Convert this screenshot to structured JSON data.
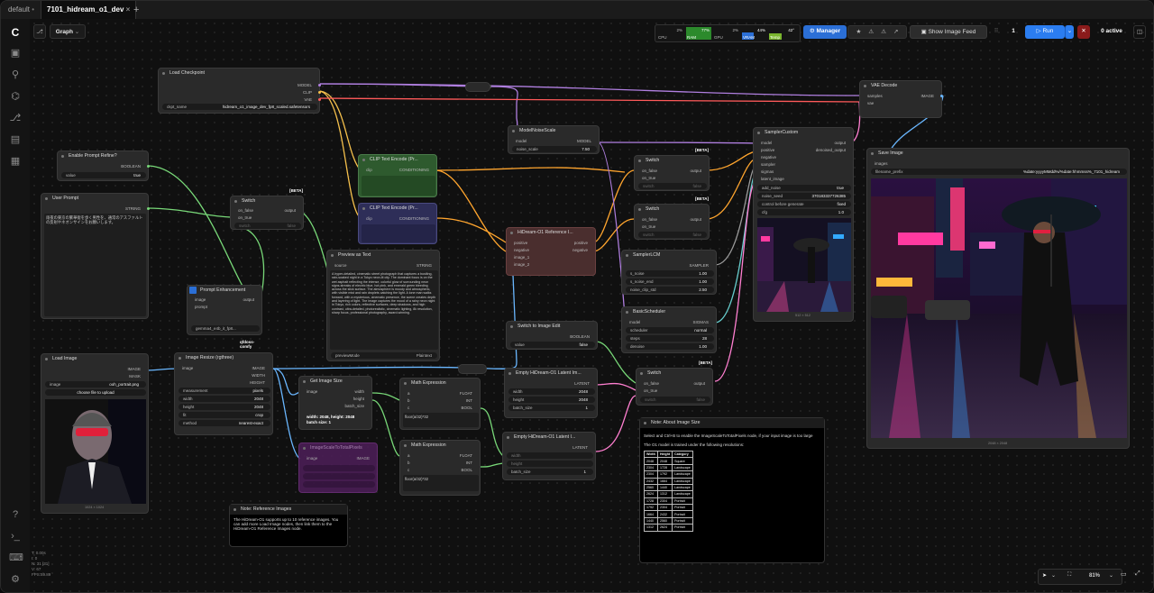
{
  "tabs": [
    {
      "label": "default"
    },
    {
      "label": "7101_hidream_o1_dev"
    }
  ],
  "graph_label": "Graph",
  "stats": {
    "cpu_pct": "2%",
    "cpu": "CPU",
    "ram_pct": "77%",
    "ram": "RAM",
    "gpu_pct": "2%",
    "gpu": "GPU",
    "vram_pct": "44%",
    "vram": "VRAM",
    "temp": "42°",
    "temp_label": "Temp"
  },
  "toolbar": {
    "manager": "Manager",
    "show_feed": "Show Image Feed",
    "queue_count": "1",
    "run": "Run",
    "active": "0 active"
  },
  "nodes": {
    "load_checkpoint": {
      "title": "Load Checkpoint",
      "out1": "MODEL",
      "out2": "CLIP",
      "out3": "VAE",
      "w_label": "ckpt_name",
      "w_value": "hidream_o1_image_dev_fp8_scaled.safetensors"
    },
    "enable_prompt": {
      "title": "Enable Prompt Refine?",
      "out": "BOOLEAN",
      "w_label": "value",
      "w_value": "true"
    },
    "user_prompt": {
      "title": "User Prompt",
      "out": "STRING",
      "text": "雨夜の東京の繁華街を歩く男性を、通常のアスファルトの反射やネオンサインをお願いします。"
    },
    "switch1": {
      "title": "Switch",
      "badge": "[BETA]",
      "in1": "on_false",
      "in2": "on_true",
      "out": "output",
      "w1": "switch",
      "w1v": "false"
    },
    "prompt_enh": {
      "title": "Prompt Enhancement",
      "in1": "image",
      "in2": "prompt",
      "out": "output",
      "w1": "gemma4_e4b_it_fp8...",
      "sub": "qfdoss-comfy"
    },
    "clip1": {
      "title": "CLIP Text Encode (Pr...",
      "in": "clip",
      "out": "CONDITIONING"
    },
    "clip2": {
      "title": "CLIP Text Encode (Pr...",
      "in": "clip",
      "out": "CONDITIONING"
    },
    "preview_text": {
      "title": "Preview as Text",
      "in": "source",
      "out": "STRING",
      "text": "A hyper-detailed, cinematic street photograph that captures a bustling, rain-soaked night in a Tokyo neon-lit city. The dominant focus is on the wet asphalt reflecting the intense, colorful glow of surrounding neon signs-streaks of electric blue, hot pink, and emerald green bleeding across the slick surface. The atmosphere is moody and atmospheric, with visible mist and rain droplets catching the light. A lone man walks forward, with a mysterious, cinematic presence, the scene creates depth and layering of light. The image captures the mood of a rainy neon night in Tokyo, rich colors, reflective surfaces, deep shadows, and high contrast, ultra-detailed, photorealistic, cinematic lighting, 8k resolution, sharp focus, professional photography, award-winning.",
      "w1": "previewMode",
      "w1v": "Plaintext"
    },
    "model_noise": {
      "title": "ModelNoiseScale",
      "in": "model",
      "out": "MODEL",
      "w1": "noise_scale",
      "w1v": "7.50"
    },
    "hidream_ref": {
      "title": "HiDream-O1 Reference I...",
      "in1": "positive",
      "in2": "negative",
      "in3": "image_1",
      "in4": "image_2",
      "out1": "positive",
      "out2": "negative"
    },
    "switch2": {
      "title": "Switch",
      "badge": "[BETA]",
      "in1": "on_false",
      "in2": "on_true",
      "out": "output",
      "w1": "switch",
      "w1v": "false"
    },
    "switch3": {
      "title": "Switch",
      "badge": "[BETA]",
      "in1": "on_false",
      "in2": "on_true",
      "out": "output",
      "w1": "switch",
      "w1v": "false"
    },
    "sampler_lcm": {
      "title": "SamplerLCM",
      "out": "SAMPLER",
      "w1": "s_noise",
      "w1v": "1.00",
      "w2": "s_noise_end",
      "w2v": "1.00",
      "w3": "noise_clip_std",
      "w3v": "2.50"
    },
    "basic_sched": {
      "title": "BasicScheduler",
      "in": "model",
      "out": "SIGMAS",
      "w1": "scheduler",
      "w1v": "normal",
      "w2": "steps",
      "w2v": "28",
      "w3": "denoise",
      "w3v": "1.00"
    },
    "switch_edit": {
      "title": "Switch to Image Edit",
      "out": "BOOLEAN",
      "w1": "value",
      "w1v": "false"
    },
    "empty_latent1": {
      "title": "Empty HiDream-O1 Latent Im...",
      "out": "LATENT",
      "w1": "width",
      "w1v": "2048",
      "w2": "height",
      "w2v": "2048",
      "w3": "batch_size",
      "w3v": "1"
    },
    "switch4": {
      "title": "Switch",
      "badge": "[BETA]",
      "in1": "on_false",
      "in2": "on_true",
      "out": "output",
      "w1": "switch",
      "w1v": "false"
    },
    "empty_latent2": {
      "title": "Empty HiDream-O1 Latent I...",
      "in1": "width",
      "in2": "height",
      "out": "LATENT",
      "w1": "batch_size",
      "w1v": "1"
    },
    "sampler_custom": {
      "title": "SamplerCustom",
      "in1": "model",
      "in2": "positive",
      "in3": "negative",
      "in4": "sampler",
      "in5": "sigmas",
      "in6": "latent_image",
      "out1": "output",
      "out2": "denoised_output",
      "w1": "add_noise",
      "w1v": "true",
      "w2": "noise_seed",
      "w2v": "370183337726385",
      "w3": "control before generate",
      "w3v": "fixed",
      "w4": "cfg",
      "w4v": "1.0",
      "caption": "512 × 512"
    },
    "vae_decode": {
      "title": "VAE Decode",
      "in1": "samples",
      "in2": "vae",
      "out": "IMAGE"
    },
    "save_image": {
      "title": "Save Image",
      "in": "images",
      "w1": "filename_prefix",
      "w1v": "%date:yyyyMMdd%/%date:hhmmss%_7101_hidream",
      "caption": "2048 × 2048"
    },
    "load_image": {
      "title": "Load Image",
      "out1": "IMAGE",
      "out2": "MASK",
      "w1": "image",
      "w1v": "ooh_portrait.png",
      "upload": "choose file to upload",
      "caption": "1024 × 1024"
    },
    "resize": {
      "title": "Image Resize (rgthree)",
      "in": "image",
      "out1": "IMAGE",
      "out2": "WIDTH",
      "out3": "HEIGHT",
      "w1": "measurement",
      "w1v": "pixels",
      "w2": "width",
      "w2v": "2048",
      "w3": "height",
      "w3v": "2048",
      "w4": "fit",
      "w4v": "crop",
      "w5": "method",
      "w5v": "nearest-exact"
    },
    "get_size": {
      "title": "Get Image Size",
      "in": "image",
      "out1": "width",
      "out2": "height",
      "out3": "batch_size",
      "text": "width: 2048, height: 2048\nbatch size: 1"
    },
    "math1": {
      "title": "Math Expression",
      "in1": "a",
      "in2": "b",
      "in3": "c",
      "out1": "FLOAT",
      "out2": "INT",
      "out3": "BOOL",
      "text": "floor(a/32)*32"
    },
    "math2": {
      "title": "Math Expression",
      "in1": "a",
      "in2": "b",
      "in3": "c",
      "out1": "FLOAT",
      "out2": "INT",
      "out3": "BOOL",
      "text": "floor(a/32)*32"
    },
    "purple_node": {
      "title": "ImageScaleToTotalPixels",
      "in": "image",
      "out": "IMAGE"
    },
    "note_ref": {
      "title": "Note: Reference Images",
      "text": "The HiDream-O1 supports up to 10 reference images. You can add more Load Image nodes, then link them to the HiDream-O1 Reference Images node."
    },
    "note_size": {
      "title": "Note: About Image Size",
      "text1": "Select and Ctrl+B to enable the ImageScaleToTotalPixels node, if your input image is too large",
      "text2": "The O1 model is trained under the following resolutions:",
      "table": [
        [
          "Width",
          "Height",
          "Category"
        ],
        [
          "2048",
          "2048",
          "Square"
        ],
        [
          "2304",
          "1728",
          "Landscape"
        ],
        [
          "2304",
          "1792",
          "Landscape"
        ],
        [
          "2432",
          "1664",
          "Landscape"
        ],
        [
          "2560",
          "1440",
          "Landscape"
        ],
        [
          "2624",
          "1312",
          "Landscape"
        ],
        [
          "1728",
          "2304",
          "Portrait"
        ],
        [
          "1792",
          "2304",
          "Portrait"
        ],
        [
          "1664",
          "2432",
          "Portrait"
        ],
        [
          "1440",
          "2560",
          "Portrait"
        ],
        [
          "1312",
          "2624",
          "Portrait"
        ]
      ]
    }
  },
  "footer": {
    "l1": "T: 0.00s",
    "l2": "I: 0",
    "l3": "N: 31 [31]",
    "l4": "V: 67",
    "l5": "FPS:59.89",
    "zoom": "81%"
  }
}
